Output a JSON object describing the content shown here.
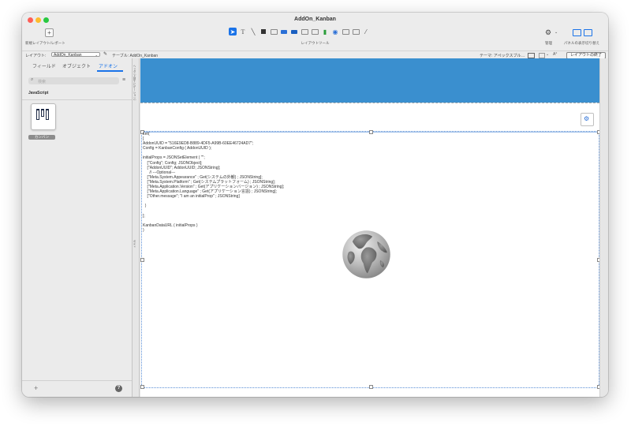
{
  "window": {
    "title": "AddOn_Kanban"
  },
  "toolbar": {
    "new_layout_label": "新規レイアウト/レポート",
    "new_layout_icon": "plus-icon",
    "tools_label": "レイアウトツール",
    "manage_label": "管理",
    "panel_label": "パネルの表示切り替え"
  },
  "layout_bar": {
    "layout_prefix": "レイアウト:",
    "layout_name": "AddOn_Kanban",
    "table_label": "テーブル: AddOn_Kanban",
    "theme_label": "テーマ: アペックスブル…",
    "exit_button": "レイアウトの終了"
  },
  "sidebar": {
    "tabs": [
      {
        "label": "フィールド"
      },
      {
        "label": "オブジェクト"
      },
      {
        "label": "アドオン"
      }
    ],
    "search_placeholder": "検索",
    "section_label": "JavaScript",
    "addon_label": "カンバン"
  },
  "canvas": {
    "ruler_header": "ヘッダ (上部ナビゲーション)",
    "ruler_body": "ボディ",
    "header_color": "#3a8fcf",
    "code_lines": [
      "Let(",
      "[",
      "AddonUUID = \"516E9ED8-B889-4DF5-A99B-60EE46724AD7\";",
      "Config = KanbanConfig ( AddonUUID );",
      "",
      "initialProps = JSONSetElement ( \"\";",
      "    [\"Config\"; Config; JSONObject];",
      "    [\"AddonUUID\"; AddonUUID; JSONString];",
      "      // ---Optional---",
      "    [\"Meta.System.Appearance\" ; Get(システムの外観) ; JSONString];",
      "    [\"Meta.System.Platform\" ; Get(システムプラットフォーム) ; JSONString];",
      "    [\"Meta.Application.Version\" ; Get(アプリケーションバージョン) ; JSONString];",
      "    [\"Meta.Application.Language\" ; Get(アプリケーション言語) ; JSONString];",
      "    [\"Other.message\"; \"I am an initialProp\" ; JSONString]",
      "",
      "  )",
      "",
      "];",
      "",
      "KanbanDataURL ( initialProps )",
      ")"
    ]
  }
}
